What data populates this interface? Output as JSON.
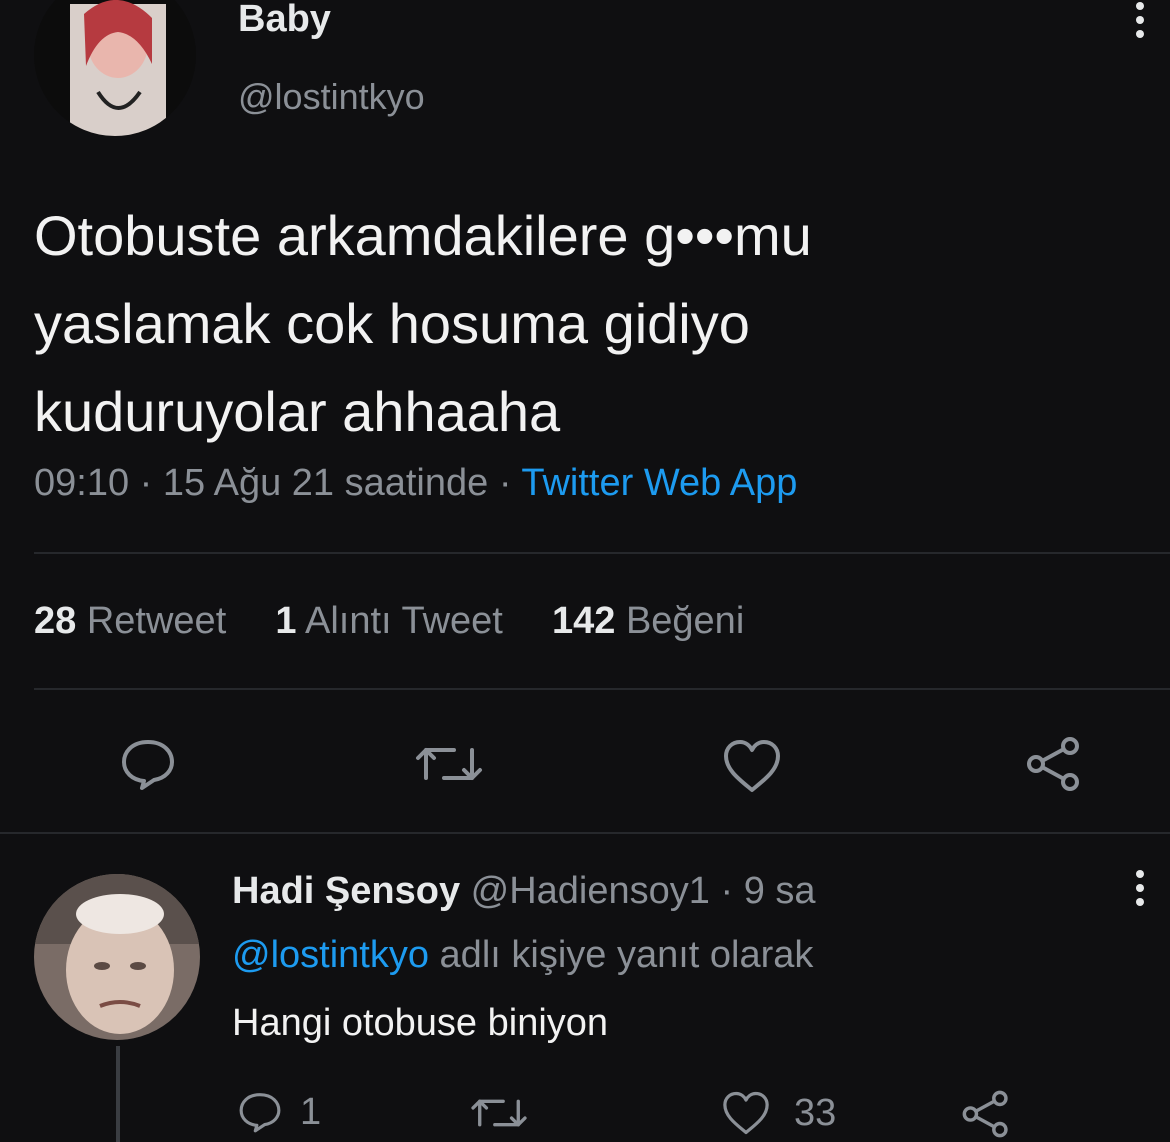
{
  "tweet": {
    "display_name": "Baby",
    "handle": "@lostintkyo",
    "text_lines": [
      "Otobuste arkamdakilere g•••mu",
      "yaslamak cok hosuma gidiyo",
      "kuduruyolar ahhaaha"
    ],
    "time": "09:10",
    "date": "15 Ağu 21 saatinde",
    "separator": "·",
    "source": "Twitter Web App",
    "stats": {
      "retweets_count": "28",
      "retweets_label": "Retweet",
      "quotes_count": "1",
      "quotes_label": "Alıntı Tweet",
      "likes_count": "142",
      "likes_label": "Beğeni"
    }
  },
  "reply": {
    "display_name": "Hadi Şensoy",
    "handle": "@Hadiensoy1",
    "time_sep": "·",
    "time": "9 sa",
    "replying_to_handle": "@lostintkyo",
    "replying_to_suffix": "adlı kişiye yanıt olarak",
    "text": "Hangi otobuse biniyon",
    "reply_count": "1",
    "like_count": "33"
  },
  "icons": {
    "more": "more-vertical-icon",
    "reply": "reply-icon",
    "retweet": "retweet-icon",
    "like": "heart-icon",
    "share": "share-icon"
  }
}
